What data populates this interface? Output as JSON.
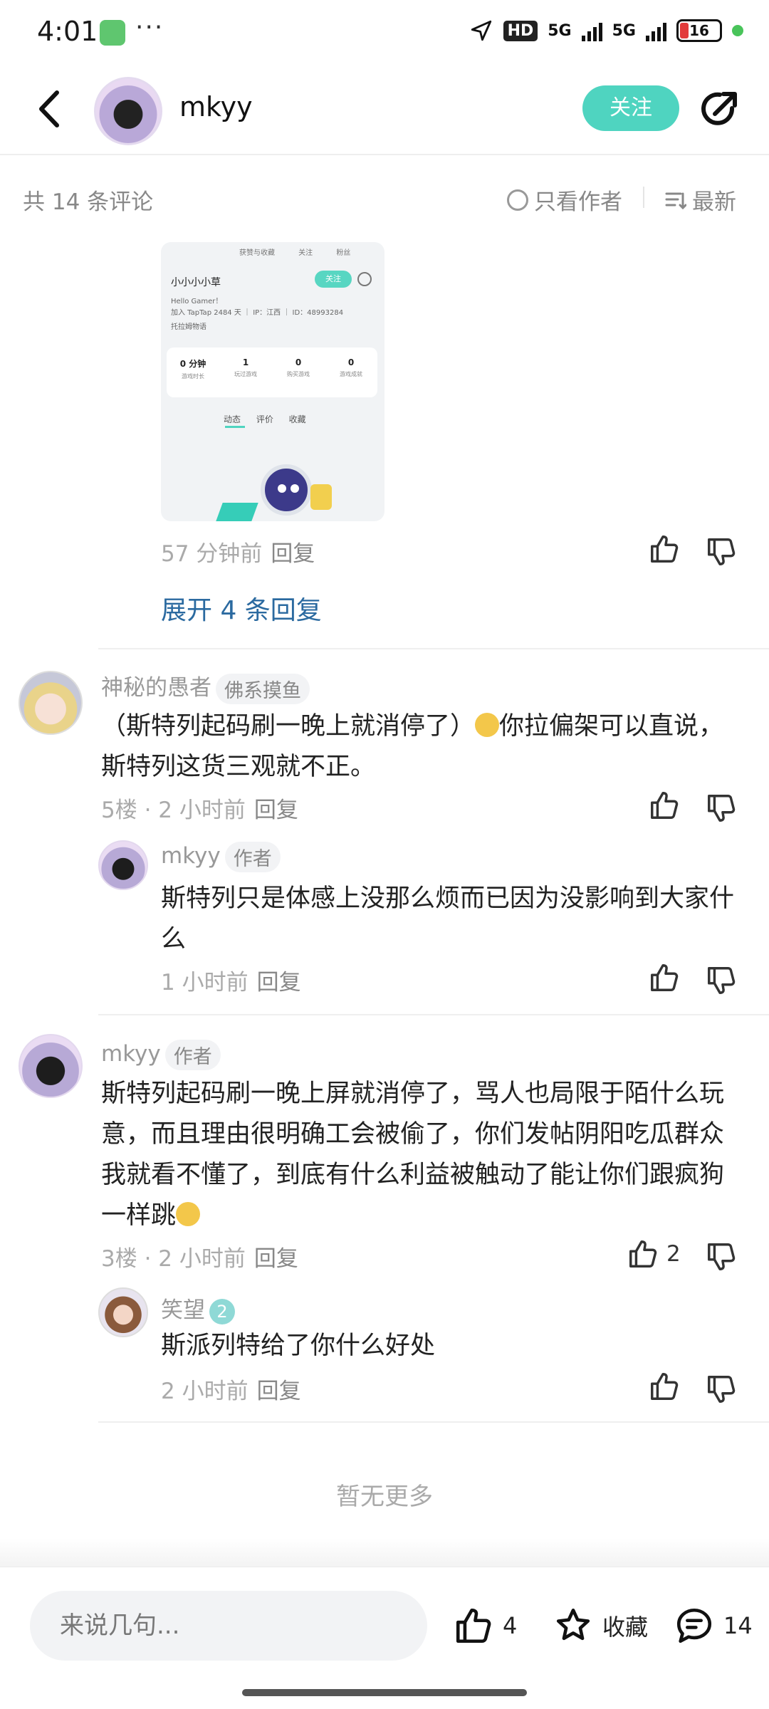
{
  "status_bar": {
    "time": "4:01",
    "network": [
      "HD",
      "5G",
      "5G"
    ],
    "battery": "16"
  },
  "header": {
    "username": "mkyy",
    "follow_label": "关注"
  },
  "comments_bar": {
    "count_text": "共 14 条评论",
    "only_author_label": "只看作者",
    "sort_label": "最新"
  },
  "embedded_image": {
    "top_tabs": "获赞与收藏 关注 粉丝",
    "name": "小小小小草",
    "follow": "关注",
    "bio": "Hello Gamer！",
    "join_info": "加入 TapTap 2484 天 ｜ IP：江西 ｜ ID：48993284",
    "game_tag": "托拉姆物语",
    "stats": [
      {
        "value": "0 分钟",
        "label": "游戏时长"
      },
      {
        "value": "1",
        "label": "玩过游戏"
      },
      {
        "value": "0",
        "label": "购买游戏"
      },
      {
        "value": "0",
        "label": "游戏成就"
      }
    ],
    "tabs": "动态 评价 收藏"
  },
  "thread0": {
    "time": "57 分钟前",
    "reply": "回复",
    "expand_label": "展开 4 条回复"
  },
  "comment5": {
    "user": "神秘的愚者",
    "badge": "佛系摸鱼",
    "text_a": "（斯特列起码刷一晚上就消停了）",
    "text_b": "你拉偏架可以直说，斯特列这货三观就不正。",
    "meta": "5楼 · 2 小时前",
    "reply": "回复",
    "sub": {
      "user": "mkyy",
      "badge": "作者",
      "text": "斯特列只是体感上没那么烦而已因为没影响到大家什么",
      "meta": "1 小时前",
      "reply": "回复"
    }
  },
  "comment3": {
    "user": "mkyy",
    "badge": "作者",
    "text": "斯特列起码刷一晚上屏就消停了，骂人也局限于陌什么玩意，而且理由很明确工会被偷了，你们发帖阴阳吃瓜群众我就看不懂了，到底有什么利益被触动了能让你们跟疯狗一样跳",
    "meta": "3楼 · 2 小时前",
    "reply": "回复",
    "like_count": "2",
    "sub": {
      "user": "笑望",
      "level": "2",
      "text": "斯派列特给了你什么好处",
      "meta": "2 小时前",
      "reply": "回复"
    }
  },
  "footer_text": "暂无更多",
  "bottom_bar": {
    "input_placeholder": "来说几句...",
    "like_count": "4",
    "fav_label": "收藏",
    "comment_count": "14"
  },
  "colors": {
    "accent": "#4fd4c0",
    "link": "#2b6aa0",
    "battery_low": "#e23b3b"
  }
}
